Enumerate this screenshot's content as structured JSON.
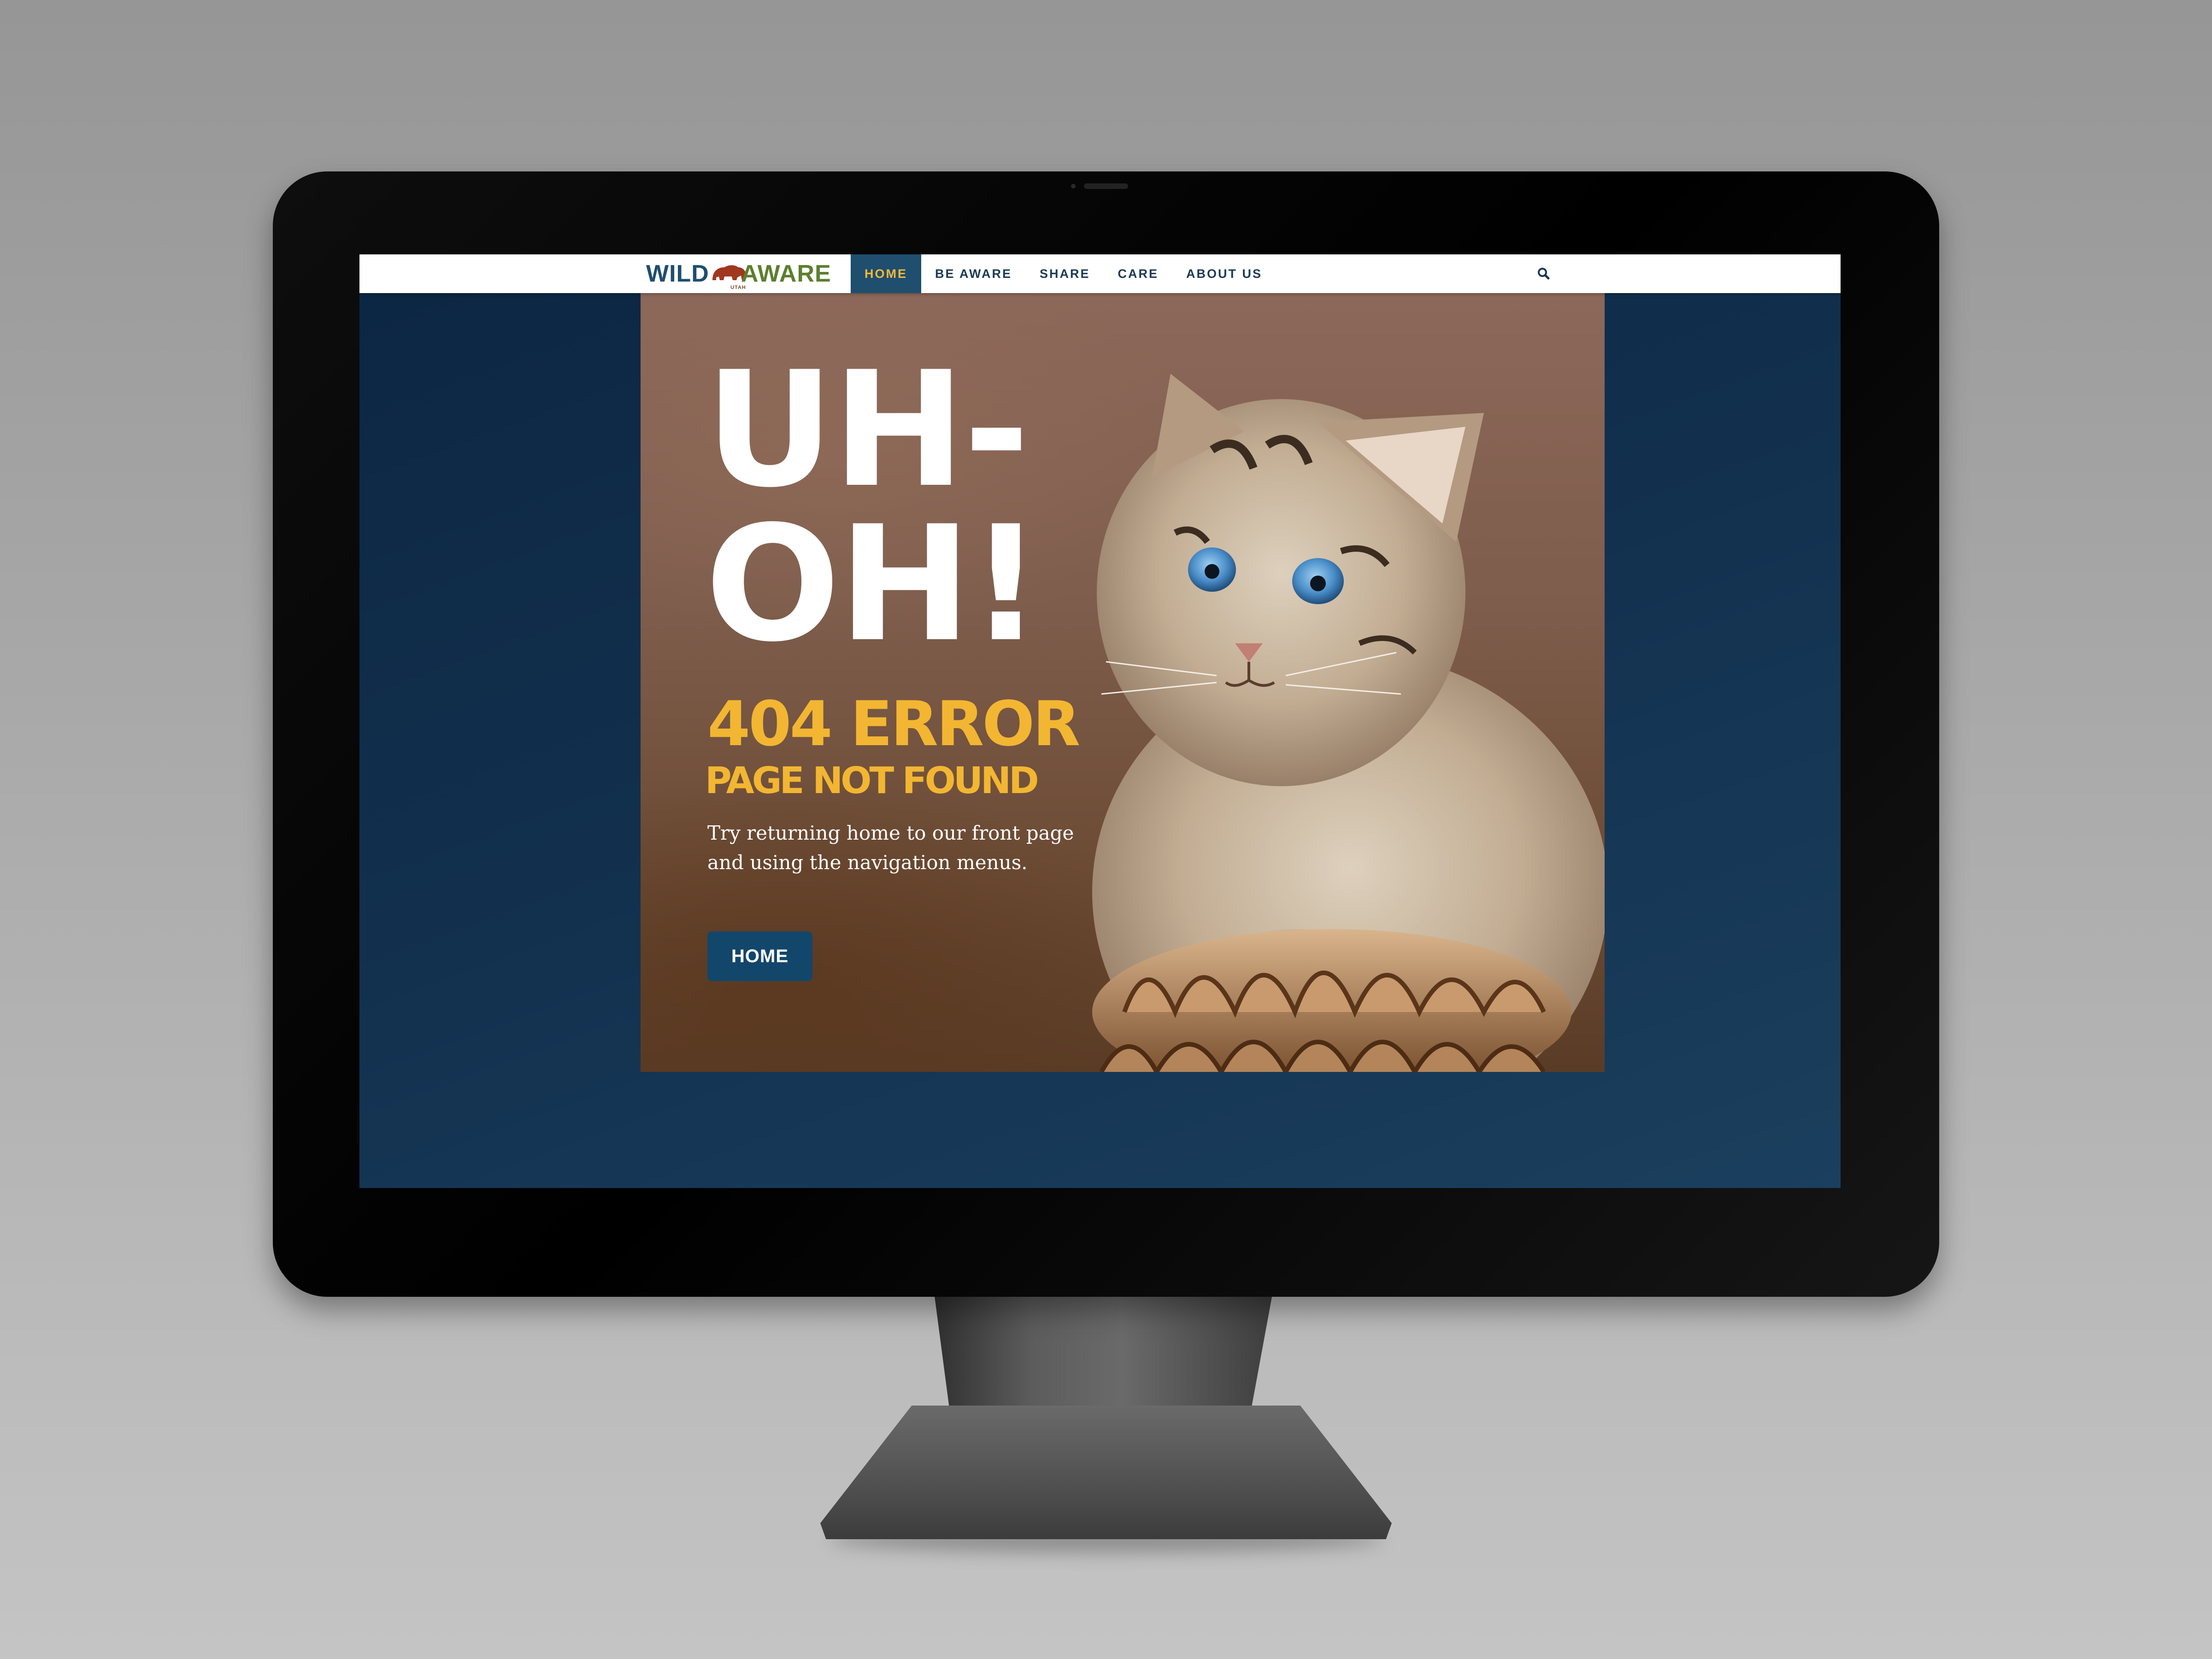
{
  "nav": {
    "logo": {
      "word_left": "WILD",
      "word_right": "AWARE",
      "sub": "UTAH"
    },
    "items": [
      {
        "label": "HOME",
        "active": true
      },
      {
        "label": "BE AWARE",
        "active": false
      },
      {
        "label": "SHARE",
        "active": false
      },
      {
        "label": "CARE",
        "active": false
      },
      {
        "label": "ABOUT US",
        "active": false
      }
    ],
    "search_icon": "search-icon"
  },
  "hero": {
    "title": "UH-OH!",
    "error": "404 ERROR",
    "subtitle": "PAGE NOT FOUND",
    "body": "Try returning home to our front page and using the navigation menus.",
    "button_label": "HOME",
    "image": "bobcat-kitten-photo"
  },
  "colors": {
    "nav_active_bg": "#1f4e6e",
    "nav_active_text": "#f4b93a",
    "accent_yellow": "#f2b632",
    "button_bg": "#13466b",
    "screen_bg": "#0c2642"
  }
}
